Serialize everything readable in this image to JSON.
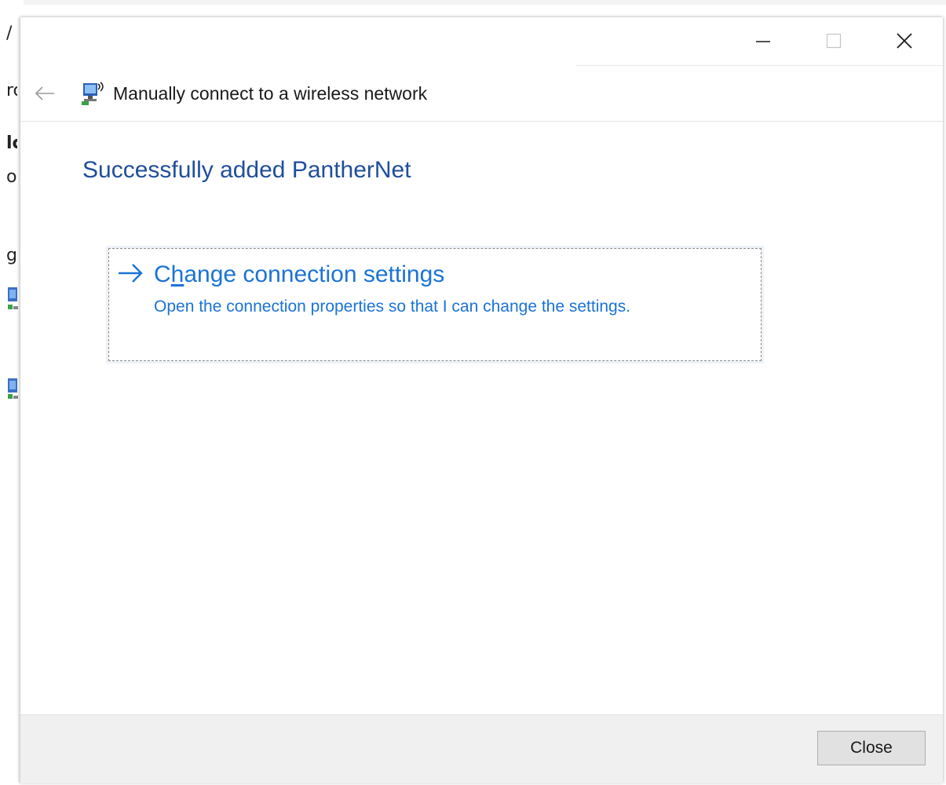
{
  "dialog": {
    "title": "Manually connect to a wireless network",
    "heading": "Successfully added PantherNet"
  },
  "window_controls": {
    "minimize_icon": "minimize-icon",
    "maximize_icon": "maximize-icon",
    "close_icon": "close-icon"
  },
  "nav": {
    "back_icon": "back-arrow-icon",
    "app_icon": "wireless-network-icon"
  },
  "command_link": {
    "title_before": "C",
    "title_accel": "h",
    "title_after": "ange connection settings",
    "description": "Open the connection properties so that I can change the settings.",
    "arrow_icon": "arrow-right-icon"
  },
  "footer": {
    "close_label": "Close"
  },
  "background_window": {
    "fragments": [
      "/",
      "rc",
      "lc",
      "oı",
      "ge"
    ]
  },
  "colors": {
    "heading": "#1f4e9c",
    "link": "#1b73d6",
    "footer_bg": "#f0f0f0",
    "button_bg": "#e1e1e1"
  }
}
